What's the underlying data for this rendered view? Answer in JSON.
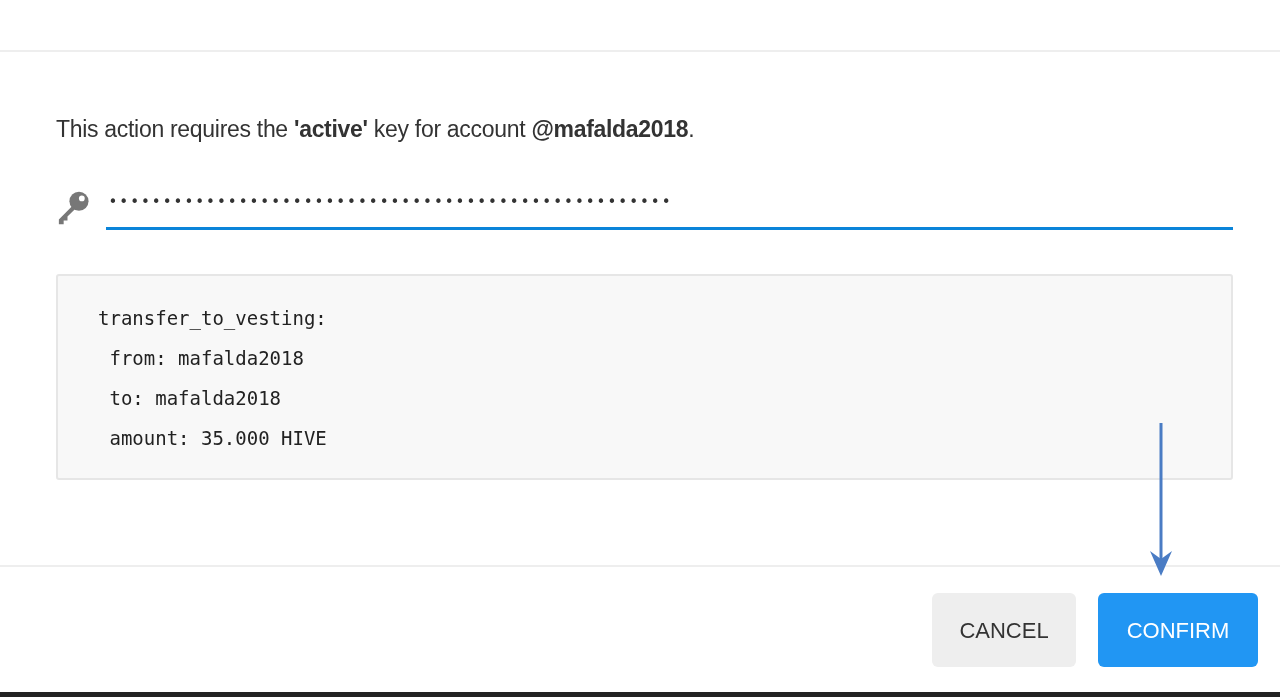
{
  "message": "This action requires the **'active'** key for account **@mafalda2018**.",
  "key_field": {
    "value": "••••••••••••••••••••••••••••••••••••••••••••••••••••",
    "focused": true
  },
  "operation": [
    "transfer_to_vesting:",
    " from: mafalda2018",
    " to: mafalda2018",
    " amount: 35.000 HIVE"
  ],
  "buttons": [
    {
      "label": "CANCEL",
      "kind": "secondary"
    },
    {
      "label": "CONFIRM",
      "kind": "primary"
    }
  ]
}
